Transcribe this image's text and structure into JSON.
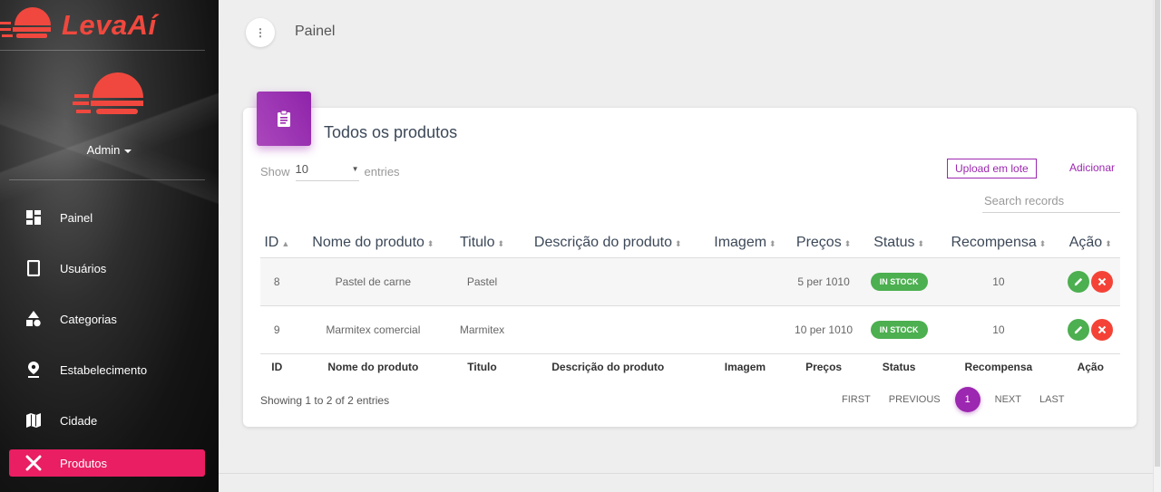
{
  "app": {
    "logo_text": "LevaAí",
    "brand_color": "#f0483e",
    "accent": "#9c27b0",
    "active_color": "#e91e63"
  },
  "user": {
    "name": "Admin"
  },
  "sidebar": {
    "items": [
      {
        "label": "Painel",
        "icon": "dashboard-icon"
      },
      {
        "label": "Usuários",
        "icon": "phone-icon"
      },
      {
        "label": "Categorias",
        "icon": "shapes-icon"
      },
      {
        "label": "Estabelecimento",
        "icon": "location-pin-icon"
      },
      {
        "label": "Cidade",
        "icon": "map-icon"
      },
      {
        "label": "Produtos",
        "icon": "utensils-icon",
        "active": true
      }
    ]
  },
  "header": {
    "title": "Painel",
    "menu_icon": "more-vertical-icon"
  },
  "card": {
    "icon": "clipboard-icon",
    "title": "Todos os produtos",
    "show_label": "Show",
    "entries_value": "10",
    "entries_label": "entries",
    "upload_label": "Upload em lote",
    "add_label": "Adicionar",
    "search_placeholder": "Search records"
  },
  "table": {
    "headers": [
      "ID",
      "Nome do produto",
      "Titulo",
      "Descrição do produto",
      "Imagem",
      "Preços",
      "Status",
      "Recompensa",
      "Ação"
    ],
    "rows": [
      {
        "id": "8",
        "name": "Pastel de carne",
        "title": "Pastel",
        "desc": "",
        "image": "",
        "price": "5 per 1010",
        "status": "IN STOCK",
        "reward": "10"
      },
      {
        "id": "9",
        "name": "Marmitex comercial",
        "title": "Marmitex",
        "desc": "",
        "image": "",
        "price": "10 per 1010",
        "status": "IN STOCK",
        "reward": "10"
      }
    ],
    "footer": [
      "ID",
      "Nome do produto",
      "Titulo",
      "Descrição do produto",
      "Imagem",
      "Preços",
      "Status",
      "Recompensa",
      "Ação"
    ]
  },
  "pagination": {
    "info": "Showing 1 to 2 of 2 entries",
    "first": "FIRST",
    "previous": "PREVIOUS",
    "current": "1",
    "next": "NEXT",
    "last": "LAST"
  }
}
